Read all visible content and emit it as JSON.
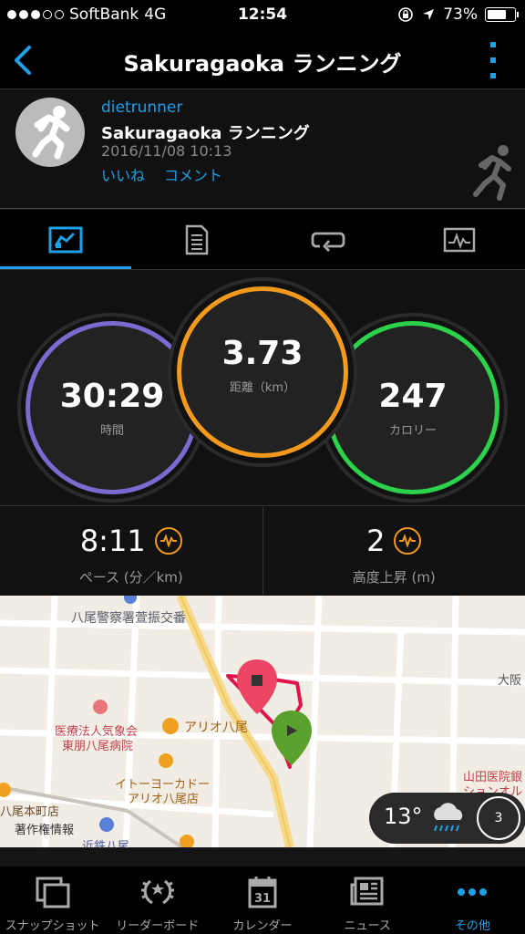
{
  "status": {
    "carrier": "SoftBank",
    "network": "4G",
    "time": "12:54",
    "battery": "73%",
    "battery_level": 0.73
  },
  "header": {
    "title": "Sakuragaoka ランニング"
  },
  "activity": {
    "username": "dietrunner",
    "name": "Sakuragaoka ランニング",
    "date": "2016/11/08 10:13",
    "like_label": "いいね",
    "comment_label": "コメント"
  },
  "tabs": [
    {
      "icon": "summary-chart-icon",
      "active": true
    },
    {
      "icon": "details-document-icon",
      "active": false
    },
    {
      "icon": "laps-loop-icon",
      "active": false
    },
    {
      "icon": "graph-monitor-icon",
      "active": false
    }
  ],
  "stats": {
    "time": {
      "value": "30:29",
      "label": "時間",
      "color": "#7b6bd0"
    },
    "distance": {
      "value": "3.73",
      "label": "距離（km）",
      "color": "#f39a1c"
    },
    "calories": {
      "value": "247",
      "label": "カロリー",
      "color": "#2bd24a"
    }
  },
  "metrics": {
    "pace": {
      "value": "8:11",
      "label": "ペース (分／km)"
    },
    "elevation": {
      "value": "2",
      "label": "高度上昇 (m)"
    }
  },
  "map": {
    "labels": {
      "police": "八尾警察署萱振交番",
      "hospital_1": "医療法人気象会",
      "hospital_2": "東朋八尾病院",
      "ario": "アリオ八尾",
      "ito_1": "イトーヨーカドー",
      "ito_2": "アリオ八尾店",
      "station": "八尾本町店",
      "copyright": "著作権情報",
      "kintetsu": "近鉄八尾",
      "osaka": "大阪",
      "yamada_1": "山田医院銀",
      "yamada_2": "ションオル"
    },
    "route_color": "#e0144a"
  },
  "weather": {
    "temperature": "13°",
    "wind_speed": "3"
  },
  "bottom_nav": [
    {
      "label": "スナップショット",
      "icon": "snapshot-icon"
    },
    {
      "label": "リーダーボード",
      "icon": "leaderboard-laurel-icon"
    },
    {
      "label": "カレンダー",
      "icon": "calendar-icon",
      "day": "31"
    },
    {
      "label": "ニュース",
      "icon": "news-icon"
    },
    {
      "label": "その他",
      "icon": "more-dots-icon",
      "active": true
    }
  ]
}
